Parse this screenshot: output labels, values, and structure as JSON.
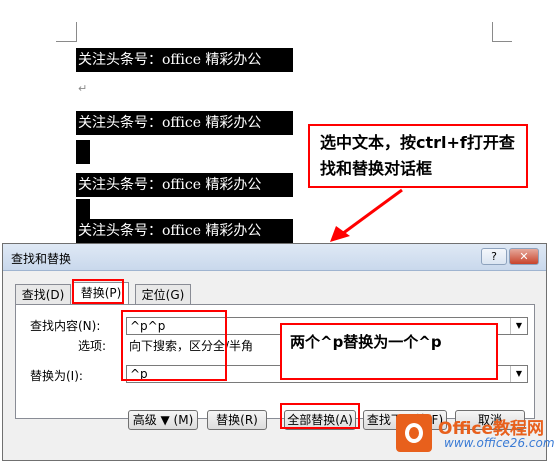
{
  "document": {
    "lines": [
      "关注头条号：office 精彩办公",
      "关注头条号：office 精彩办公",
      "关注头条号：office 精彩办公",
      "关注头条号：office 精彩办公"
    ],
    "paragraph_mark": "↵"
  },
  "callout": {
    "text": "选中文本，按ctrl+f打开查找和替换对话框"
  },
  "dialog": {
    "title": "查找和替换",
    "help_button": "?",
    "close_button": "✕",
    "tabs": [
      "查找(D)",
      "替换(P)",
      "定位(G)"
    ],
    "active_tab": "替换(P)",
    "find_label": "查找内容(N):",
    "find_value": "^p^p",
    "options_label": "选项:",
    "options_value": "向下搜索，区分全/半角",
    "replace_label": "替换为(I):",
    "replace_value": "^p",
    "buttons": {
      "more": "高级 ▼ (M)",
      "replace": "替换(R)",
      "replace_all": "全部替换(A)",
      "find_next": "查找下一处(F)",
      "cancel": "取消"
    }
  },
  "note": {
    "text": "两个^p替换为一个^p"
  },
  "watermark": {
    "brand": "Office教程网",
    "url": "www.office26.com"
  }
}
